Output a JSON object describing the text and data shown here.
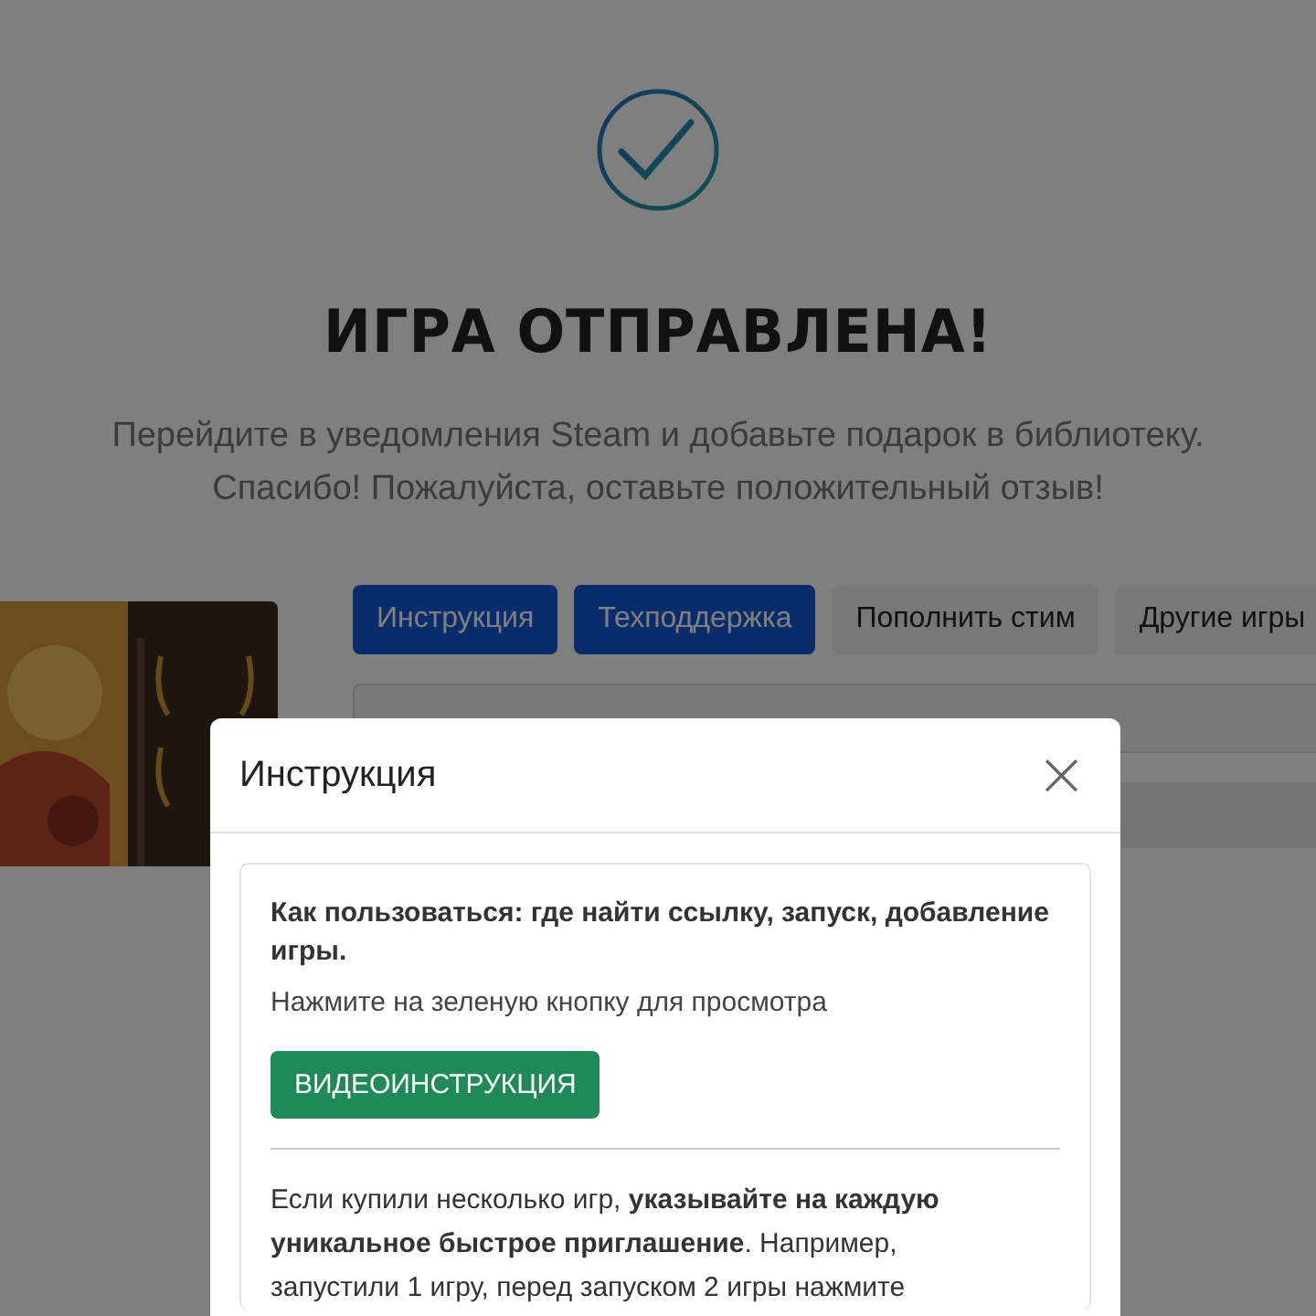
{
  "page": {
    "title": "ИГРА ОТПРАВЛЕНА!",
    "subtitle_lines": [
      "Перейдите в уведомления Steam и добавьте подарок в библиотеку.",
      "Спасибо! Пожалуйста, оставьте положительный отзыв!"
    ],
    "buttons": [
      {
        "label": "Инструкция",
        "kind": "primary"
      },
      {
        "label": "Техподдержка",
        "kind": "primary"
      },
      {
        "label": "Пополнить стим",
        "kind": "light"
      },
      {
        "label": "Другие игры",
        "kind": "light"
      }
    ]
  },
  "dialog": {
    "title": "Инструкция",
    "close": "×",
    "heading": "Как пользоваться: где найти ссылку, запуск, добавление игры.",
    "hint": "Нажмите на зеленую кнопку для просмотра",
    "video_button": "ВИДЕОИНСТРУКЦИЯ",
    "paragraph": "Если купили несколько игр, **указывайте на каждую уникальное быстрое приглашение**. Например, запустили 1 игру, перед запуском 2 игры нажмите"
  }
}
